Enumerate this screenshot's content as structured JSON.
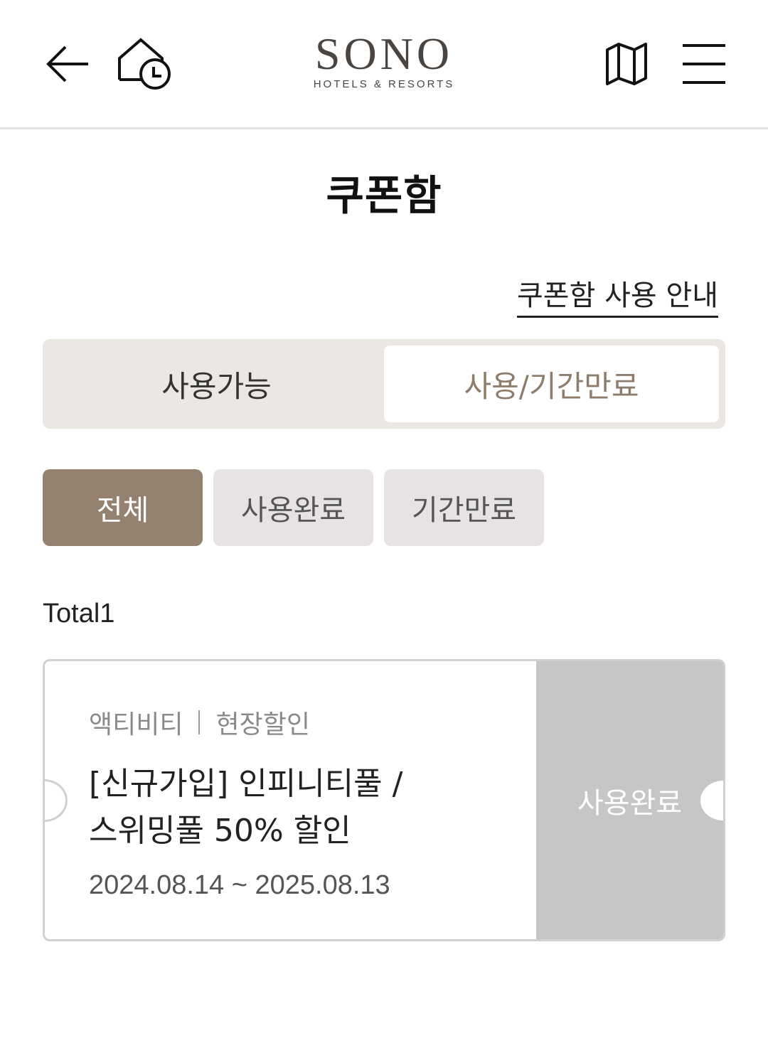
{
  "header": {
    "logo_main": "SONO",
    "logo_sub": "HOTELS & RESORTS",
    "icons": [
      "back-arrow-icon",
      "recent-home-clock-icon",
      "map-icon",
      "hamburger-menu-icon"
    ]
  },
  "page_title": "쿠폰함",
  "guide_link": "쿠폰함 사용 안내",
  "segment_tabs": [
    {
      "label": "사용가능",
      "active": false
    },
    {
      "label": "사용/기간만료",
      "active": true
    }
  ],
  "filter_chips": [
    {
      "label": "전체",
      "active": true
    },
    {
      "label": "사용완료",
      "active": false
    },
    {
      "label": "기간만료",
      "active": false
    }
  ],
  "total_text": "Total1",
  "coupons": [
    {
      "category": "액티비티",
      "type": "현장할인",
      "title_line1": "[신규가입] 인피니티풀 /",
      "title_line2": "스위밍풀 50% 할인",
      "period": "2024.08.14 ~ 2025.08.13",
      "status": "사용완료"
    }
  ],
  "colors": {
    "accent_brown": "#948170",
    "accent_text": "#8f7d6b",
    "segment_bg": "#ebe7e2",
    "chip_bg": "#e6e3e2",
    "used_panel": "#c6c6c6"
  }
}
